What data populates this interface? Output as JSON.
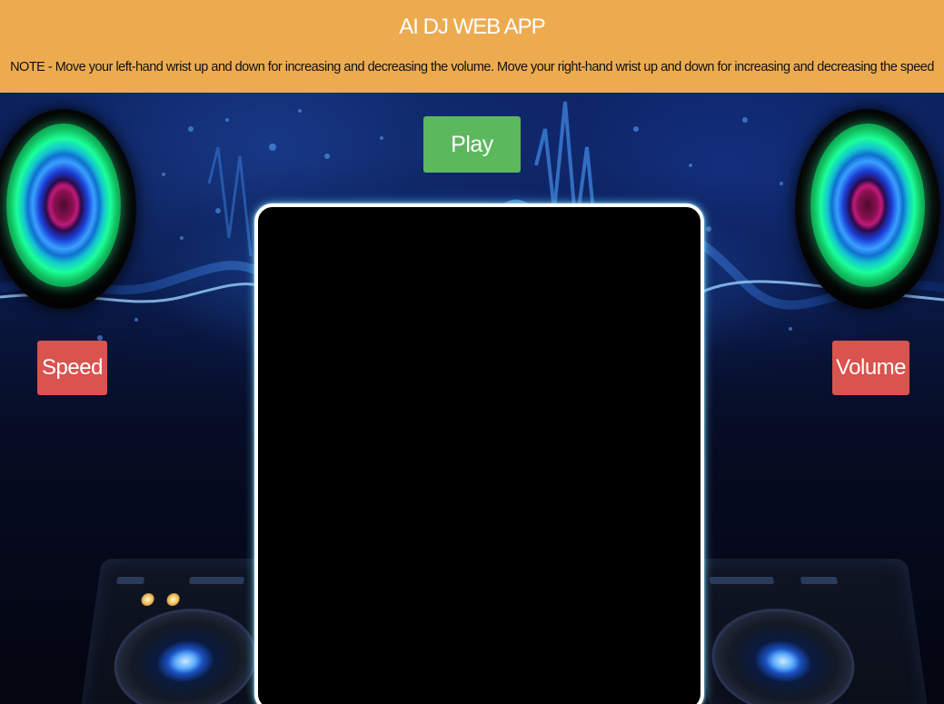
{
  "header": {
    "title": "AI DJ WEB APP",
    "note": "NOTE - Move your left-hand wrist up and down for increasing and decreasing the volume. Move your right-hand wrist up and down for increasing and decreasing the speed",
    "background_color": "#edab50"
  },
  "controls": {
    "play_label": "Play",
    "speed_label": "Speed",
    "volume_label": "Volume",
    "play_color": "#5cb85c",
    "speed_color": "#d9534f",
    "volume_color": "#d9534f"
  }
}
